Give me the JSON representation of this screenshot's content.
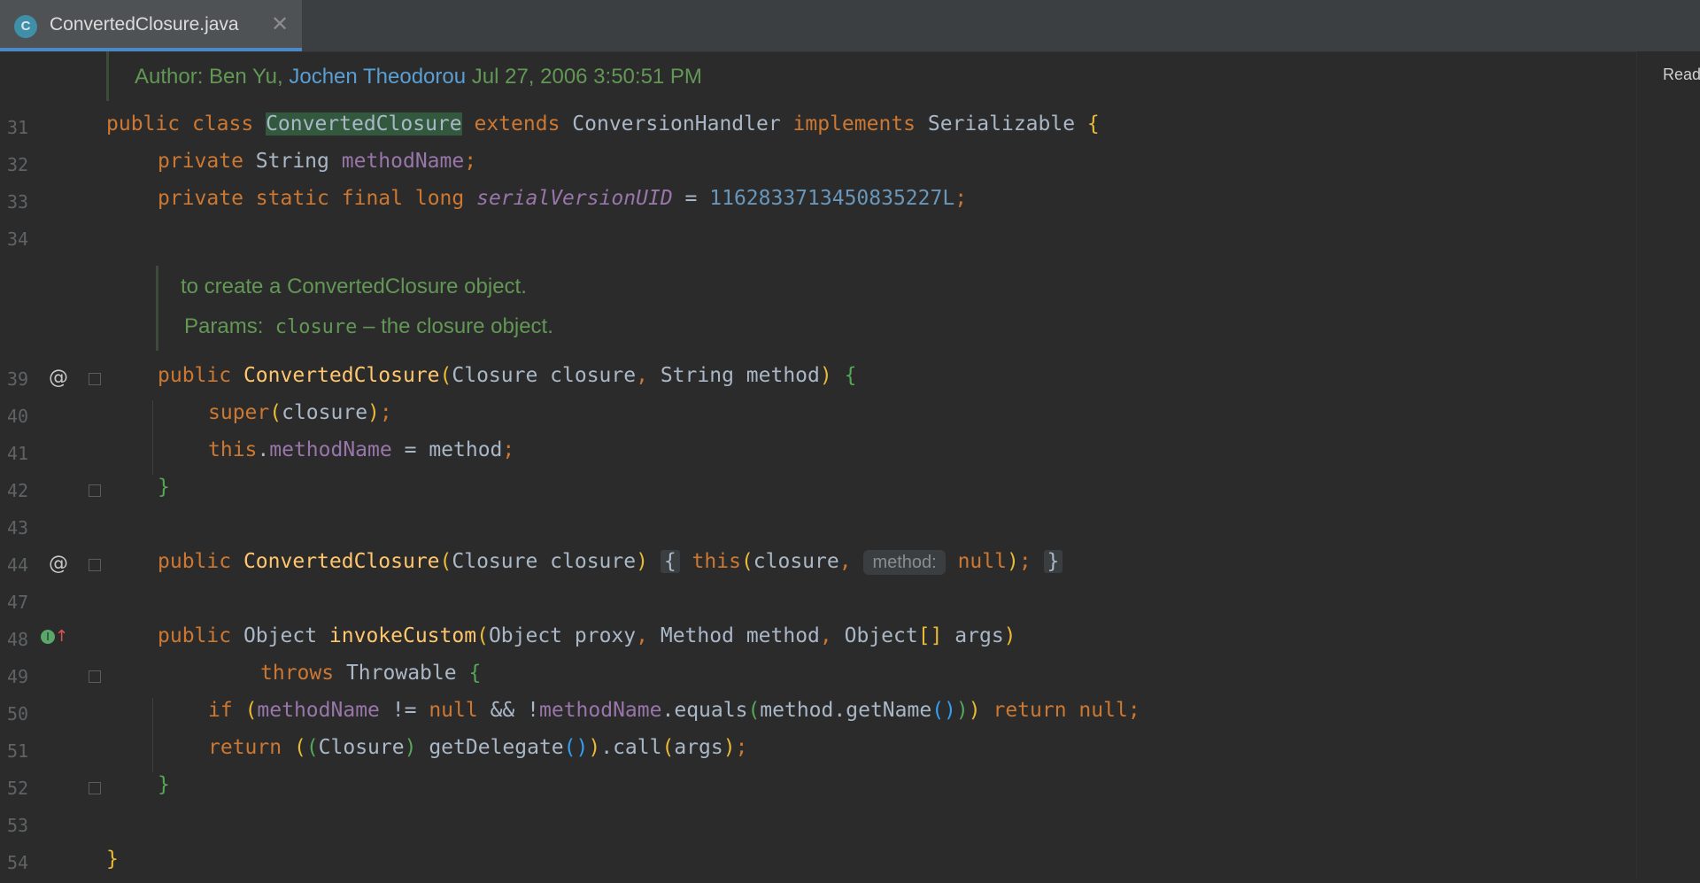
{
  "tab": {
    "icon_letter": "C",
    "title": "ConvertedClosure.java",
    "close": "✕"
  },
  "right_panel": {
    "label": "Reader Mode"
  },
  "doc_author": {
    "prefix": "Author: ",
    "name1": "Ben Yu, ",
    "name2": "Jochen Theodorou",
    "date": " Jul 27, 2006 3:50:51 PM"
  },
  "doc_ctor": {
    "line1": "to create a ConvertedClosure object.",
    "params_label": "Params: ",
    "param_name": "closure",
    "param_desc": " – the closure object."
  },
  "lines": {
    "l31": "31",
    "l32": "32",
    "l33": "33",
    "l34": "34",
    "l39": "39",
    "l40": "40",
    "l41": "41",
    "l42": "42",
    "l43": "43",
    "l44": "44",
    "l47": "47",
    "l48": "48",
    "l49": "49",
    "l50": "50",
    "l51": "51",
    "l52": "52",
    "l53": "53",
    "l54": "54"
  },
  "code": {
    "public": "public",
    "class": "class",
    "className": "ConvertedClosure",
    "extends": "extends",
    "superType": "ConversionHandler",
    "implements": "implements",
    "iface": "Serializable",
    "private": "private",
    "String": "String",
    "methodName": "methodName",
    "static": "static",
    "final": "final",
    "long": "long",
    "serialVersionUID": "serialVersionUID",
    "uidValue": "1162833713450835227L",
    "Closure": "Closure",
    "closure": "closure",
    "method": "method",
    "super": "super",
    "this": "this",
    "hintLabel": "method:",
    "null": "null",
    "Object": "Object",
    "invokeCustom": "invokeCustom",
    "proxy": "proxy",
    "Method": "Method",
    "args": "args",
    "throws": "throws",
    "Throwable": "Throwable",
    "if": "if",
    "equals": "equals",
    "getName": "getName",
    "return": "return",
    "getDelegate": "getDelegate",
    "call": "call"
  },
  "gutter": {
    "override_icon": "@",
    "implements_icon": "I↑"
  }
}
